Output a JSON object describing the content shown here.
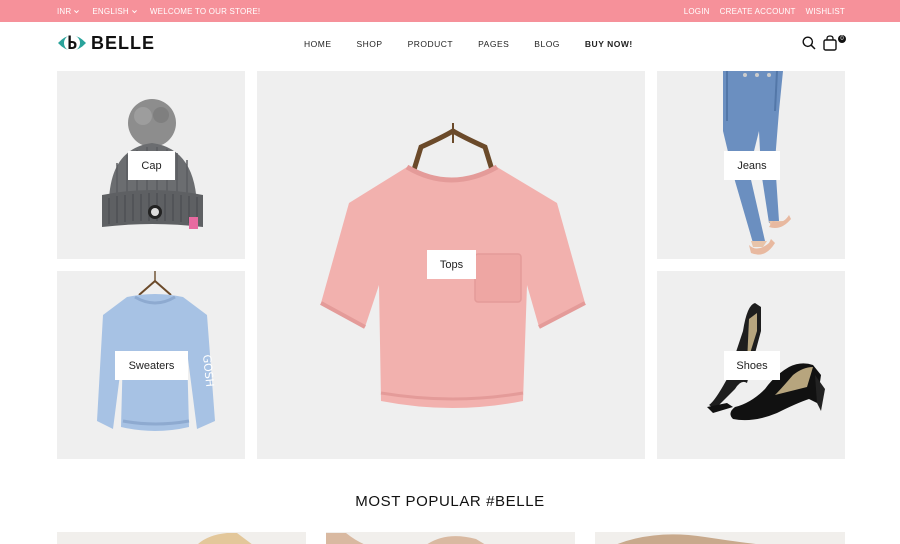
{
  "topbar": {
    "currency": "INR",
    "language": "ENGLISH",
    "welcome": "WELCOME TO OUR STORE!",
    "login": "LOGIN",
    "create_account": "CREATE ACCOUNT",
    "wishlist": "WISHLIST",
    "bg_color": "#f6919a"
  },
  "header": {
    "logo_text": "BELLE",
    "nav": [
      "HOME",
      "SHOP",
      "PRODUCT",
      "PAGES",
      "BLOG",
      "BUY NOW!"
    ],
    "cart_count": "0",
    "icons": [
      "search-icon",
      "shopping-bag-icon"
    ]
  },
  "categories": {
    "cap": "Cap",
    "sweaters": "Sweaters",
    "tops": "Tops",
    "jeans": "Jeans",
    "shoes": "Shoes"
  },
  "section": {
    "title": "MOST POPULAR #BELLE"
  }
}
